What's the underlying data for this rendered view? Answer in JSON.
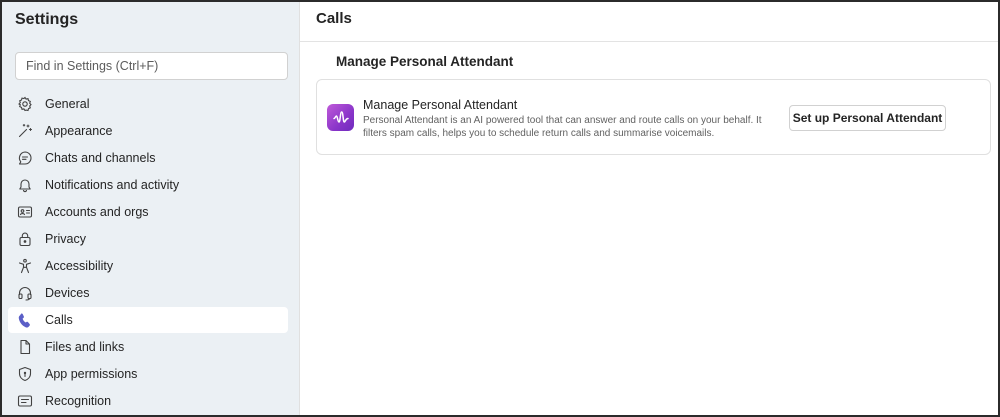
{
  "sidebar": {
    "title": "Settings",
    "search_placeholder": "Find in Settings (Ctrl+F)",
    "items": [
      {
        "label": "General",
        "icon": "gear-icon",
        "active": false
      },
      {
        "label": "Appearance",
        "icon": "magic-wand-icon",
        "active": false
      },
      {
        "label": "Chats and channels",
        "icon": "chat-bubble-icon",
        "active": false
      },
      {
        "label": "Notifications and activity",
        "icon": "bell-icon",
        "active": false
      },
      {
        "label": "Accounts and orgs",
        "icon": "id-card-icon",
        "active": false
      },
      {
        "label": "Privacy",
        "icon": "lock-icon",
        "active": false
      },
      {
        "label": "Accessibility",
        "icon": "accessibility-icon",
        "active": false
      },
      {
        "label": "Devices",
        "icon": "headset-icon",
        "active": false
      },
      {
        "label": "Calls",
        "icon": "phone-icon",
        "active": true
      },
      {
        "label": "Files and links",
        "icon": "document-icon",
        "active": false
      },
      {
        "label": "App permissions",
        "icon": "shield-icon",
        "active": false
      },
      {
        "label": "Recognition",
        "icon": "recognition-icon",
        "active": false
      }
    ]
  },
  "main": {
    "title": "Calls",
    "section_title": "Manage Personal Attendant",
    "card": {
      "icon": "personal-attendant-icon",
      "title": "Manage Personal Attendant",
      "description": "Personal Attendant is an AI powered tool that can answer and route calls on your behalf. It filters spam calls, helps you to schedule return calls and summarise voicemails.",
      "button_label": "Set up Personal Attendant"
    }
  },
  "colors": {
    "sidebar_bg": "#ebf0f4",
    "active_icon": "#5b5fc7",
    "app_icon_gradient_start": "#c05ad9",
    "app_icon_gradient_end": "#6e2bbd"
  }
}
